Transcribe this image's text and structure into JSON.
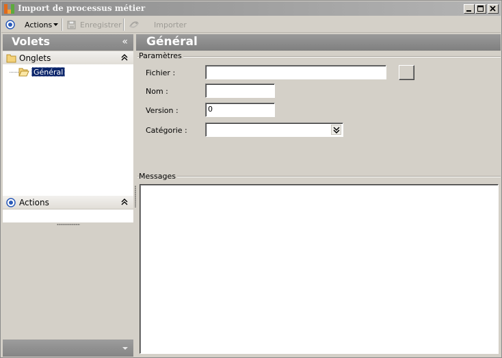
{
  "window": {
    "title": "Import de processus métier",
    "minimize_icon": "minimize-icon",
    "maximize_icon": "maximize-icon",
    "close_icon": "close-icon"
  },
  "toolbar": {
    "actions_label": "Actions",
    "save_label": "Enregistrer",
    "import_label": "Importer"
  },
  "left_panel": {
    "title": "Volets",
    "collapse_glyph": "«",
    "tabs_group": {
      "label": "Onglets"
    },
    "tree": [
      {
        "label": "Général",
        "selected": true
      }
    ],
    "actions_group": {
      "label": "Actions"
    }
  },
  "main": {
    "title": "Général",
    "parameters_section": "Paramètres",
    "fields": {
      "file": {
        "label": "Fichier :",
        "value": ""
      },
      "name": {
        "label": "Nom :",
        "value": ""
      },
      "version": {
        "label": "Version :",
        "value": "0"
      },
      "category": {
        "label": "Catégorie :",
        "value": ""
      }
    },
    "messages_section": "Messages"
  },
  "colors": {
    "header_gray": "#8c8c8c",
    "selection": "#0a246a",
    "background": "#d4d0c8"
  }
}
